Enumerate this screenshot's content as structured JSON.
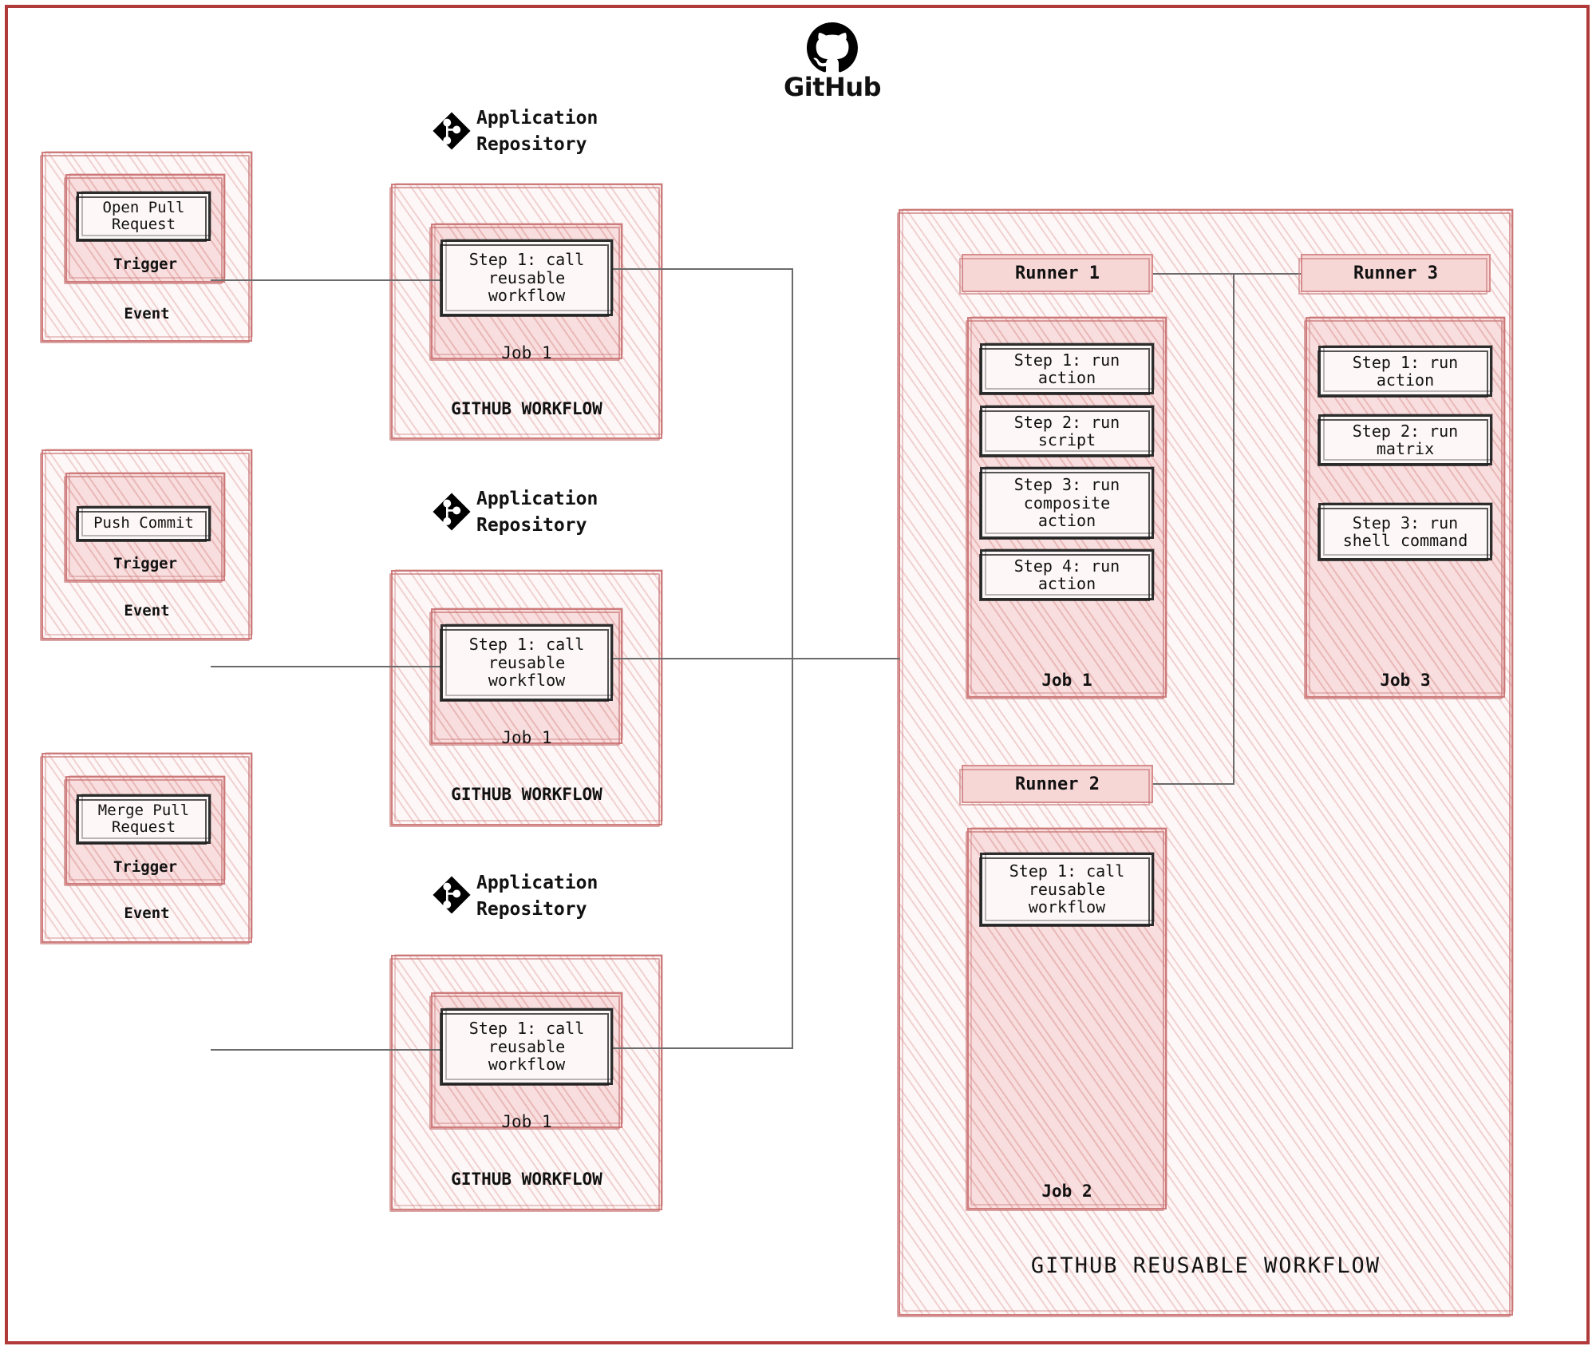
{
  "header": {
    "brand_label": "GitHub",
    "brand_icon": "github-mark-icon"
  },
  "colors": {
    "frame": "#b03a3a",
    "container_border": "#cf7d7d",
    "hatch_light_bg": "#fdf7f7",
    "hatch_mid_bg": "#f8dede",
    "step_border": "#2e2e2e",
    "step_bg": "#fdf7f8",
    "connector": "#6b6b6b",
    "runner_bg": "#f7d6d6"
  },
  "left_column": {
    "events": [
      {
        "outer_label": "Event",
        "inner_label": "Trigger",
        "step_label": "Open Pull\nRequest"
      },
      {
        "outer_label": "Event",
        "inner_label": "Trigger",
        "step_label": "Push Commit"
      },
      {
        "outer_label": "Event",
        "inner_label": "Trigger",
        "step_label": "Merge Pull\nRequest"
      }
    ]
  },
  "middle_column": {
    "repositories": [
      {
        "title_line1": "Application",
        "title_line2": "Repository",
        "icon": "git-logo-icon",
        "workflow_label": "GITHUB WORKFLOW",
        "job_label": "Job 1",
        "step_label": "Step 1: call\nreusable\nworkflow"
      },
      {
        "title_line1": "Application",
        "title_line2": "Repository",
        "icon": "git-logo-icon",
        "workflow_label": "GITHUB WORKFLOW",
        "job_label": "Job 1",
        "step_label": "Step 1: call\nreusable\nworkflow"
      },
      {
        "title_line1": "Application",
        "title_line2": "Repository",
        "icon": "git-logo-icon",
        "workflow_label": "GITHUB WORKFLOW",
        "job_label": "Job 1",
        "step_label": "Step 1: call\nreusable\nworkflow"
      }
    ]
  },
  "reusable_workflow": {
    "panel_label": "GITHUB REUSABLE WORKFLOW",
    "runners": [
      {
        "name": "Runner 1"
      },
      {
        "name": "Runner 2"
      },
      {
        "name": "Runner 3"
      }
    ],
    "jobs": [
      {
        "label": "Job 1",
        "runner": "Runner 1",
        "steps": [
          "Step 1: run\naction",
          "Step 2: run\nscript",
          "Step 3: run\ncomposite\naction",
          "Step 4: run\naction"
        ]
      },
      {
        "label": "Job 2",
        "runner": "Runner 2",
        "steps": [
          "Step 1: call\nreusable\nworkflow"
        ]
      },
      {
        "label": "Job 3",
        "runner": "Runner 3",
        "steps": [
          "Step 1: run\naction",
          "Step 2: run\nmatrix",
          "Step 3: run\nshell command"
        ]
      }
    ]
  }
}
